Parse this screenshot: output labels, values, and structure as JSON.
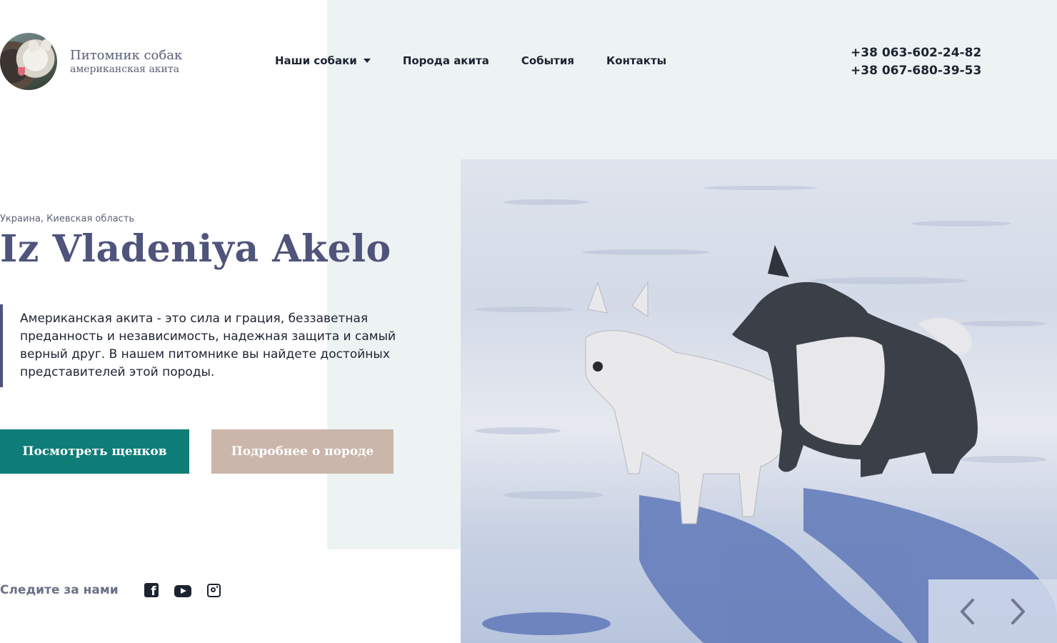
{
  "header": {
    "logo_title": "Питомник собак",
    "logo_subtitle": "американская акита",
    "nav": [
      {
        "label": "Наши собаки",
        "has_dropdown": true
      },
      {
        "label": "Порода акита"
      },
      {
        "label": "События"
      },
      {
        "label": "Контакты"
      }
    ],
    "phones": [
      "+38 063-602-24-82",
      "+38 067-680-39-53"
    ]
  },
  "hero": {
    "region": "Украина, Киевская область",
    "title": "Iz Vladeniya Akelo",
    "description": "Американская акита - это сила и грация, беззаветная преданность и независимость, надежная защита и самый верный друг. В нашем питомнике вы найдете достойных представителей этой породы.",
    "primary_button": "Посмотреть щенков",
    "secondary_button": "Подробнее о породе"
  },
  "social": {
    "label": "Следите за нами",
    "icons": [
      "facebook-icon",
      "youtube-icon",
      "instagram-icon"
    ]
  },
  "slider": {
    "prev_icon": "chevron-left-icon",
    "next_icon": "chevron-right-icon"
  },
  "colors": {
    "accent": "#4f547b",
    "primary_button": "#0e7d78",
    "secondary_button": "#cbb6ab",
    "panel": "#edf3f3"
  }
}
